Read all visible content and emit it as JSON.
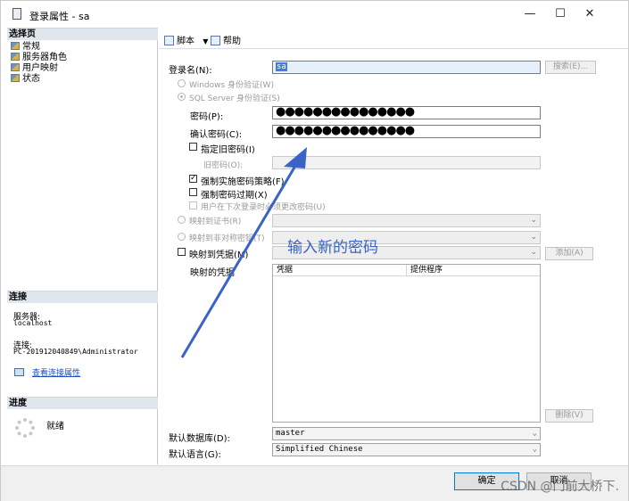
{
  "window": {
    "title": "登录属性 - sa",
    "minimize": "—",
    "maximize": "☐",
    "close": "✕"
  },
  "left": {
    "select_page_header": "选择页",
    "pages": [
      "常规",
      "服务器角色",
      "用户映射",
      "状态"
    ],
    "connection_header": "连接",
    "server_label": "服务器:",
    "server_value": "localhost",
    "connect_label": "连接:",
    "connect_value": "PC-201912040849\\Administrator",
    "view_props_link": "查看连接属性",
    "progress_header": "进度",
    "progress_status": "就绪"
  },
  "toolbar": {
    "script_label": "脚本",
    "help_label": "帮助"
  },
  "form": {
    "login_name_label": "登录名(N):",
    "login_name_value": "sa",
    "search_button": "搜索(E)...",
    "windows_auth": "Windows 身份验证(W)",
    "sql_auth": "SQL Server 身份验证(S)",
    "password_label": "密码(P):",
    "password_value": "●●●●●●●●●●●●●●●",
    "confirm_label": "确认密码(C):",
    "confirm_value": "●●●●●●●●●●●●●●●",
    "specify_old": "指定旧密码(I)",
    "old_password_label": "旧密码(O):",
    "enforce_policy": "强制实施密码策略(F)",
    "enforce_expiration": "强制密码过期(X)",
    "must_change": "用户在下次登录时必须更改密码(U)",
    "map_cert": "映射到证书(R)",
    "map_asym": "映射到非对称密钥(T)",
    "map_cred": "映射到凭据(M)",
    "add_button": "添加(A)",
    "mapped_creds_label": "映射的凭据",
    "grid_col_cred": "凭据",
    "grid_col_provider": "提供程序",
    "remove_button": "删除(V)",
    "default_db_label": "默认数据库(D):",
    "default_db_value": "master",
    "default_lang_label": "默认语言(G):",
    "default_lang_value": "Simplified Chinese"
  },
  "buttons": {
    "ok": "确定",
    "cancel": "取消"
  },
  "annotation": {
    "text": "输入新的密码",
    "color": "#3a63c7"
  },
  "watermark": "CSDN @门前大桥下."
}
